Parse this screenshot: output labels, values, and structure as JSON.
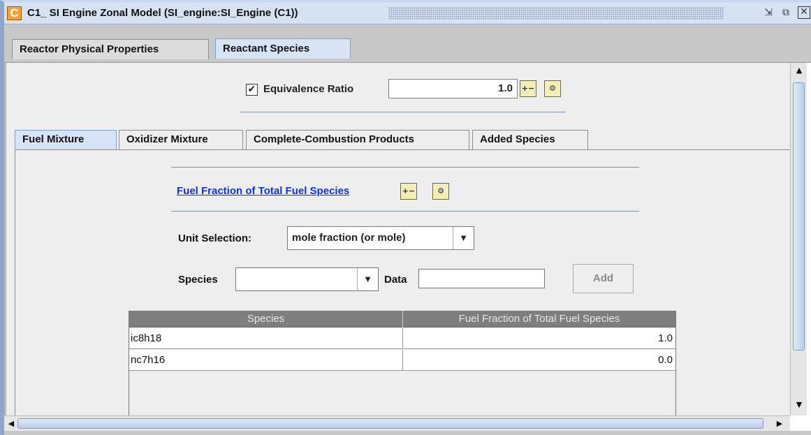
{
  "window": {
    "icon_letter": "C",
    "title": "C1_ SI Engine Zonal Model  (SI_engine:SI_Engine (C1))"
  },
  "top_tabs": [
    {
      "label": "Reactor Physical Properties",
      "active": false
    },
    {
      "label": "Reactant Species",
      "active": true
    }
  ],
  "equivalence": {
    "checked": true,
    "label": "Equivalence Ratio",
    "value": "1.0"
  },
  "inner_tabs": [
    {
      "label": "Fuel Mixture",
      "active": true
    },
    {
      "label": "Oxidizer Mixture",
      "active": false
    },
    {
      "label": "Complete-Combustion Products",
      "active": false
    },
    {
      "label": "Added Species",
      "active": false
    }
  ],
  "fuel_panel": {
    "link_text": "Fuel Fraction of Total Fuel Species",
    "unit_label": "Unit Selection:",
    "unit_value": "mole fraction (or mole)",
    "species_label": "Species",
    "species_value": "",
    "data_label": "Data",
    "data_value": "",
    "add_label": "Add"
  },
  "table": {
    "columns": [
      "Species",
      "Fuel Fraction of Total Fuel Species"
    ],
    "rows": [
      [
        "ic8h18",
        "1.0"
      ],
      [
        "nc7h16",
        "0.0"
      ]
    ]
  },
  "colors": {
    "accent_active_tab": "#d7e4f5",
    "link": "#0a32e6",
    "table_header": "#7e7e7e"
  }
}
